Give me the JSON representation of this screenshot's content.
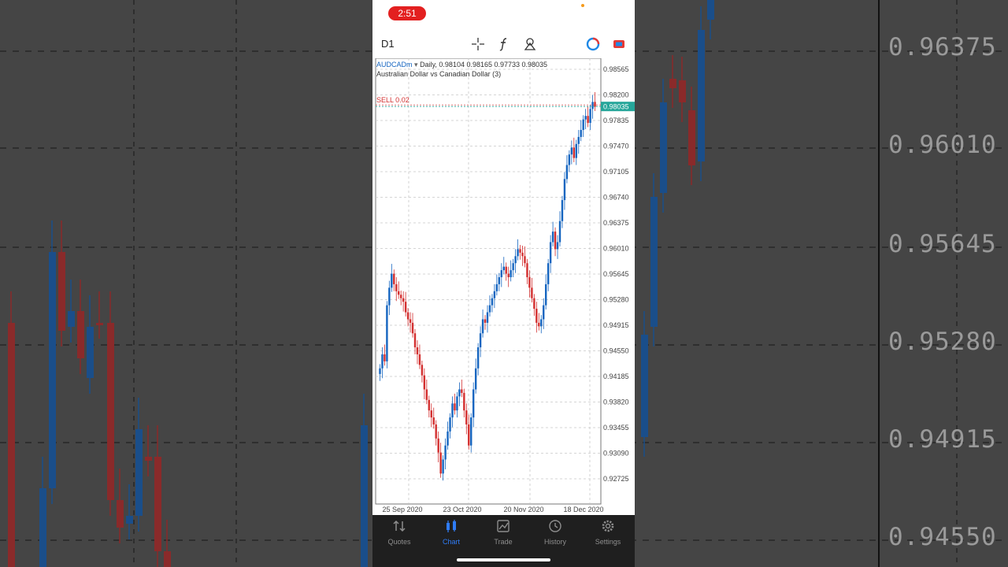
{
  "status_bar": {
    "time": "2:51"
  },
  "toolbar": {
    "timeframe": "D1",
    "icons": [
      "crosshair-icon",
      "indicator-f-icon",
      "objects-icon",
      "account-icon",
      "trade-icon"
    ]
  },
  "chart": {
    "symbol": "AUDCADm",
    "period": "Daily",
    "ohlc": "0.98104 0.98165 0.97733 0.98035",
    "description": "Australian Dollar vs Canadian Dollar (3)",
    "sell_label": "SELL 0.02",
    "bid_label": "0.98035",
    "colors": {
      "bull": "#1565c0",
      "bear": "#d32f2f",
      "bid_bg": "#26a69a",
      "grid": "#c8c8c8"
    }
  },
  "chart_data": {
    "type": "candlestick",
    "y_ticks": [
      "0.98565",
      "0.98200",
      "0.97835",
      "0.97470",
      "0.97105",
      "0.96740",
      "0.96375",
      "0.96010",
      "0.95645",
      "0.95280",
      "0.94915",
      "0.94550",
      "0.94185",
      "0.93820",
      "0.93455",
      "0.93090",
      "0.92725"
    ],
    "x_ticks": [
      "25 Sep 2020",
      "23 Oct 2020",
      "20 Nov 2020",
      "18 Dec 2020"
    ],
    "ylim": [
      0.9265,
      0.9866
    ],
    "last_price": 0.98035,
    "close_path": [
      0.943,
      0.945,
      0.944,
      0.952,
      0.9545,
      0.9565,
      0.955,
      0.954,
      0.9535,
      0.953,
      0.9525,
      0.951,
      0.95,
      0.9495,
      0.948,
      0.946,
      0.945,
      0.9435,
      0.942,
      0.94,
      0.9385,
      0.937,
      0.936,
      0.935,
      0.933,
      0.931,
      0.928,
      0.93,
      0.932,
      0.934,
      0.936,
      0.938,
      0.937,
      0.939,
      0.94,
      0.9395,
      0.937,
      0.935,
      0.932,
      0.936,
      0.94,
      0.943,
      0.946,
      0.948,
      0.95,
      0.9495,
      0.951,
      0.952,
      0.953,
      0.954,
      0.955,
      0.956,
      0.957,
      0.9575,
      0.9565,
      0.956,
      0.957,
      0.958,
      0.959,
      0.96,
      0.9595,
      0.959,
      0.958,
      0.956,
      0.9545,
      0.953,
      0.9515,
      0.9495,
      0.949,
      0.95,
      0.952,
      0.955,
      0.958,
      0.961,
      0.9625,
      0.96,
      0.961,
      0.964,
      0.967,
      0.97,
      0.972,
      0.9735,
      0.9745,
      0.973,
      0.975,
      0.976,
      0.977,
      0.9785,
      0.979,
      0.978,
      0.98,
      0.981,
      0.9803
    ]
  },
  "tabs": [
    {
      "label": "Quotes",
      "icon": "quotes-icon",
      "active": false
    },
    {
      "label": "Chart",
      "icon": "chart-icon",
      "active": true
    },
    {
      "label": "Trade",
      "icon": "trade-tab-icon",
      "active": false
    },
    {
      "label": "History",
      "icon": "history-icon",
      "active": false
    },
    {
      "label": "Settings",
      "icon": "settings-icon",
      "active": false
    }
  ],
  "background": {
    "prices": [
      "0.96375",
      "0.96010",
      "0.95645",
      "0.95280",
      "0.94915",
      "0.94550"
    ]
  }
}
